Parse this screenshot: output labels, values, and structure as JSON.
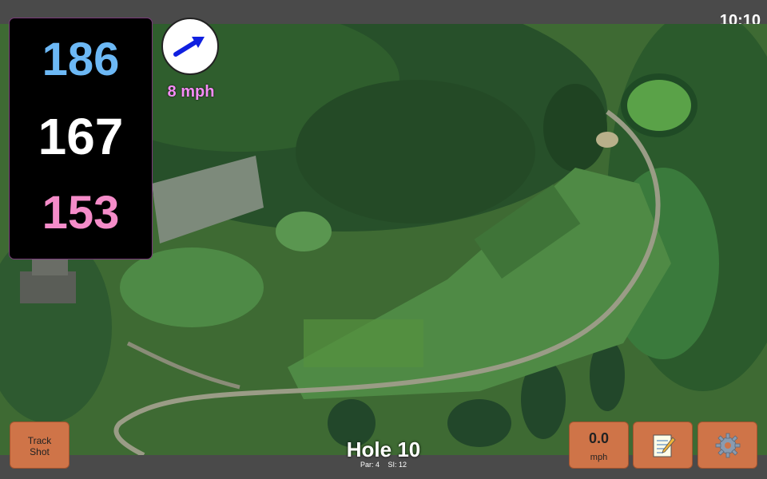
{
  "status_bar": {
    "time": "10:10"
  },
  "distances": {
    "back": "186",
    "middle": "167",
    "front": "153"
  },
  "wind": {
    "speed": "8 mph",
    "icon": "wind-arrow-icon"
  },
  "buttons": {
    "track_shot": {
      "line1": "Track",
      "line2": "Shot"
    },
    "speed": {
      "value": "0.0",
      "unit": "mph"
    },
    "notes_icon": "notepad-icon",
    "settings_icon": "gear-icon"
  },
  "hole": {
    "title": "Hole 10",
    "par": "Par: 4",
    "si": "SI: 12"
  },
  "colors": {
    "back": "#6cb8f5",
    "middle": "#ffffff",
    "front": "#f58cc9",
    "button": "#cf7448",
    "wind": "#f58cf5"
  }
}
